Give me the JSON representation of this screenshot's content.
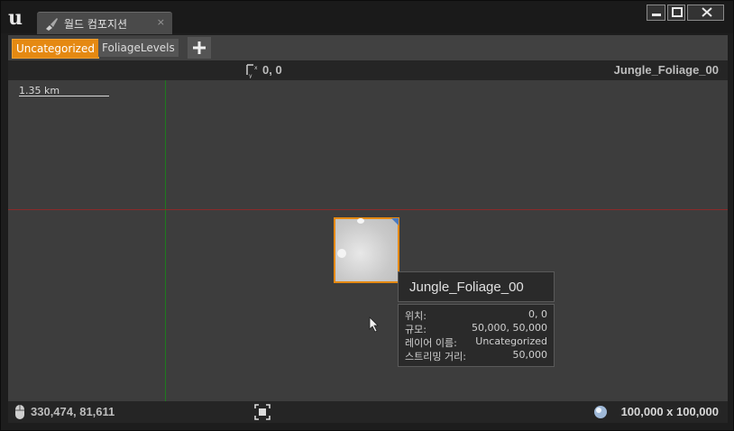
{
  "window": {
    "tab_title": "월드 컴포지션",
    "tab_close": "×"
  },
  "toolbar": {
    "levels": [
      "Uncategorized",
      "FoliageLevels"
    ],
    "active_level": "Uncategorized",
    "add_symbol": "+"
  },
  "viewport": {
    "header_coords": "0, 0",
    "world_name": "Jungle_Foliage_00",
    "scale_label": "1.35 km",
    "mouse_coords": "330,474, 81,611",
    "world_size": "100,000 x 100,000"
  },
  "tooltip": {
    "title": "Jungle_Foliage_00",
    "rows": [
      {
        "key": "위치:",
        "value": "0, 0"
      },
      {
        "key": "규모:",
        "value": "50,000, 50,000"
      },
      {
        "key": "레이어 이름:",
        "value": "Uncategorized"
      },
      {
        "key": "스트리밍 거리:",
        "value": "50,000"
      }
    ]
  },
  "colors": {
    "accent": "#e58912",
    "axis_x": "#8a2a2a",
    "axis_y": "#1e7a1e"
  }
}
